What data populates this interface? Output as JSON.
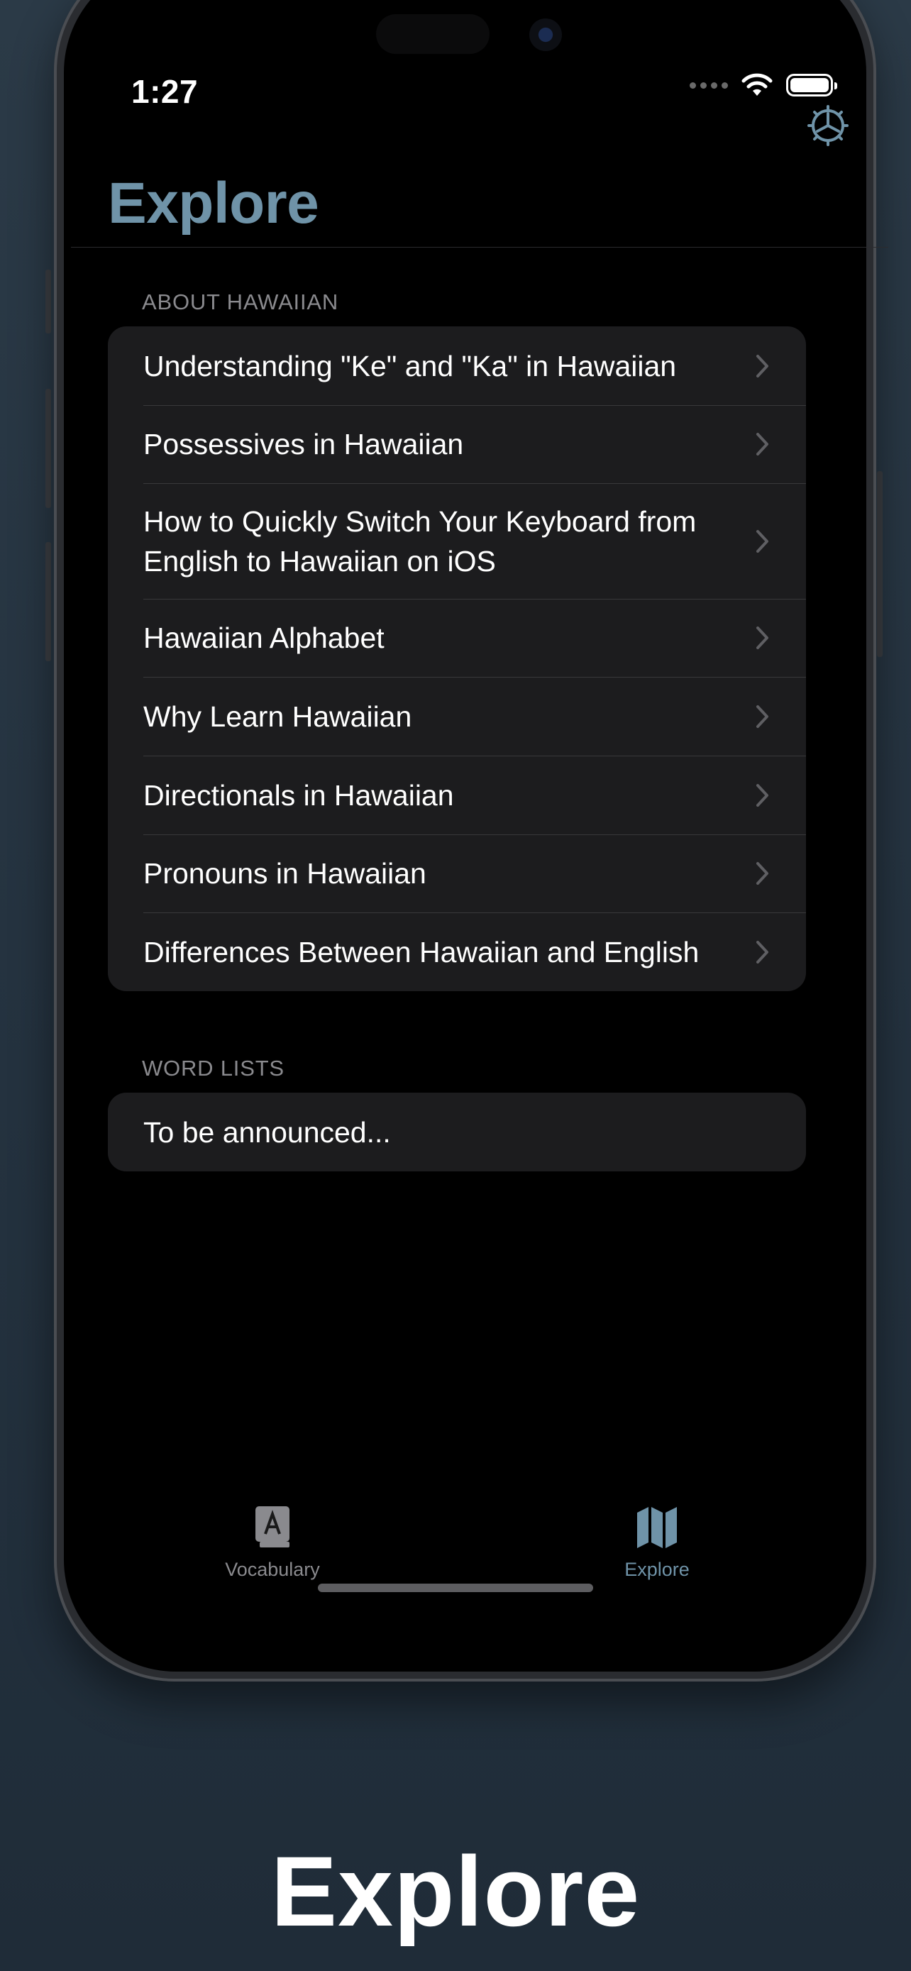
{
  "status_bar": {
    "time": "1:27"
  },
  "header": {
    "title": "Explore"
  },
  "sections": [
    {
      "header": "ABOUT HAWAIIAN",
      "items": [
        {
          "label": "Understanding \"Ke\" and \"Ka\" in Hawaiian"
        },
        {
          "label": "Possessives in Hawaiian"
        },
        {
          "label": "How to Quickly Switch Your Keyboard from English to Hawaiian on iOS"
        },
        {
          "label": "Hawaiian Alphabet"
        },
        {
          "label": "Why Learn Hawaiian"
        },
        {
          "label": "Directionals in Hawaiian"
        },
        {
          "label": "Pronouns in Hawaiian"
        },
        {
          "label": "Differences Between Hawaiian and English"
        }
      ]
    },
    {
      "header": "WORD LISTS",
      "items": [
        {
          "label": "To be announced..."
        }
      ]
    }
  ],
  "tabs": [
    {
      "label": "Vocabulary",
      "icon": "book-icon",
      "selected": false
    },
    {
      "label": "Explore",
      "icon": "map-icon",
      "selected": true
    }
  ],
  "caption": "Explore",
  "colors": {
    "accent": "#6f93a8",
    "background": "#000000",
    "group_background": "#1c1c1e",
    "inactive_tab": "#8a8a8e"
  }
}
